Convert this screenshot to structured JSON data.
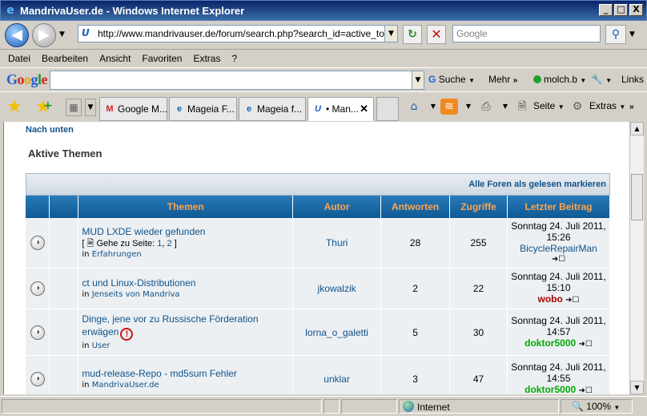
{
  "window": {
    "title": "MandrivaUser.de - Windows Internet Explorer",
    "buttons": [
      "_",
      "□",
      "X"
    ]
  },
  "address_bar": {
    "url": "http://www.mandrivauser.de/forum/search.php?search_id=active_topics",
    "search_placeholder": "Google"
  },
  "menu": [
    "Datei",
    "Bearbeiten",
    "Ansicht",
    "Favoriten",
    "Extras",
    "?"
  ],
  "google_toolbar": {
    "logo": "Google",
    "search_label": "Suche",
    "more_label": "Mehr",
    "user": "molch.b",
    "links": "Links"
  },
  "tabs": [
    {
      "label": "Google M...",
      "icon": "gmail-icon",
      "active": false
    },
    {
      "label": "Mageia F...",
      "icon": "ie-page-icon",
      "active": false
    },
    {
      "label": "Mageia f...",
      "icon": "ie-page-icon",
      "active": false
    },
    {
      "label": "• Man...",
      "icon": "site-favicon",
      "active": true
    }
  ],
  "commandbar": {
    "page_label": "Seite",
    "tools_label": "Extras"
  },
  "page": {
    "nav_down": "Nach unten",
    "title": "Aktive Themen",
    "mark_read": "Alle Foren als gelesen markieren",
    "columns": [
      "Themen",
      "Autor",
      "Antworten",
      "Zugriffe",
      "Letzter Beitrag"
    ],
    "rows": [
      {
        "title": "MUD LXDE wieder gefunden",
        "pages_prefix": "[",
        "pages_label": "Gehe zu Seite:",
        "page_links": [
          "1",
          "2"
        ],
        "pages_suffix": "]",
        "in_label": "in",
        "forum": "Erfahrungen",
        "author": "Thuri",
        "replies": "28",
        "views": "255",
        "last_date": "Sonntag 24. Juli 2011, 15:26",
        "last_user": "BicycleRepairMan",
        "last_user_color": "#105289",
        "has_alert": false
      },
      {
        "title": "ct und Linux-Distributionen",
        "pages_label": "",
        "page_links": [],
        "in_label": "in",
        "forum": "Jenseits von Mandriva",
        "author": "jkowalzik",
        "replies": "2",
        "views": "22",
        "last_date": "Sonntag 24. Juli 2011, 15:10",
        "last_user": "wobo",
        "last_user_color": "#aa0000",
        "has_alert": false
      },
      {
        "title": "Dinge, jene vor zu Russische Förderation erwägen",
        "pages_label": "",
        "page_links": [],
        "in_label": "in",
        "forum": "User",
        "author": "lorna_o_galetti",
        "replies": "5",
        "views": "30",
        "last_date": "Sonntag 24. Juli 2011, 14:57",
        "last_user": "doktor5000",
        "last_user_color": "#00aa00",
        "has_alert": true
      },
      {
        "title": "mud-release-Repo - md5sum Fehler",
        "pages_label": "",
        "page_links": [],
        "in_label": "in",
        "forum": "MandrivaUser.de",
        "author": "unklar",
        "replies": "3",
        "views": "47",
        "last_date": "Sonntag 24. Juli 2011, 14:55",
        "last_user": "doktor5000",
        "last_user_color": "#00aa00",
        "has_alert": false
      }
    ]
  },
  "status_bar": {
    "zone": "Internet",
    "zoom": "100%"
  }
}
